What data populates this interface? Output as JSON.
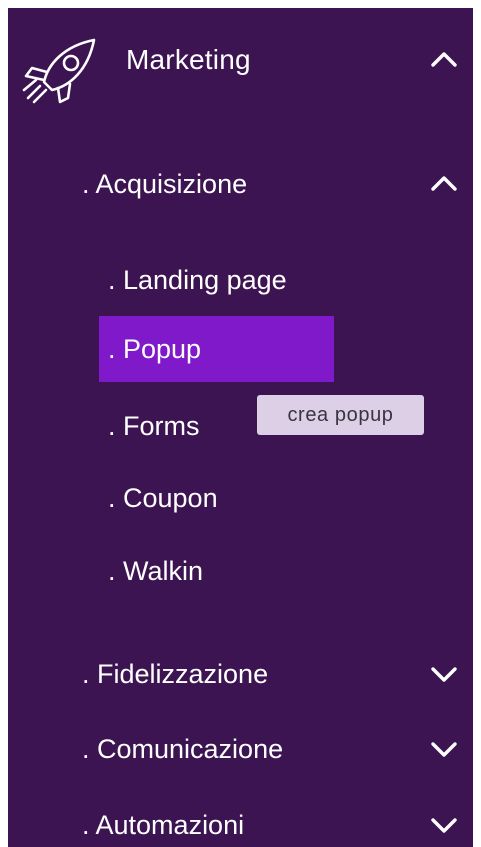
{
  "menu": {
    "title": "Marketing",
    "icon": "rocket-icon",
    "expanded": true,
    "sections": [
      {
        "label": ". Acquisizione",
        "expanded": true,
        "items": [
          {
            "label": ". Landing page",
            "active": false
          },
          {
            "label": ". Popup",
            "active": true
          },
          {
            "label": ". Forms",
            "active": false
          },
          {
            "label": ". Coupon",
            "active": false
          },
          {
            "label": ". Walkin",
            "active": false
          }
        ]
      },
      {
        "label": ". Fidelizzazione",
        "expanded": false
      },
      {
        "label": ". Comunicazione",
        "expanded": false
      },
      {
        "label": ". Automazioni",
        "expanded": false
      }
    ]
  },
  "tooltip": {
    "text": "crea popup"
  },
  "colors": {
    "background": "#3d1452",
    "active_item": "#8019c9",
    "tooltip_bg": "#ddd0e6",
    "text": "#ffffff"
  }
}
